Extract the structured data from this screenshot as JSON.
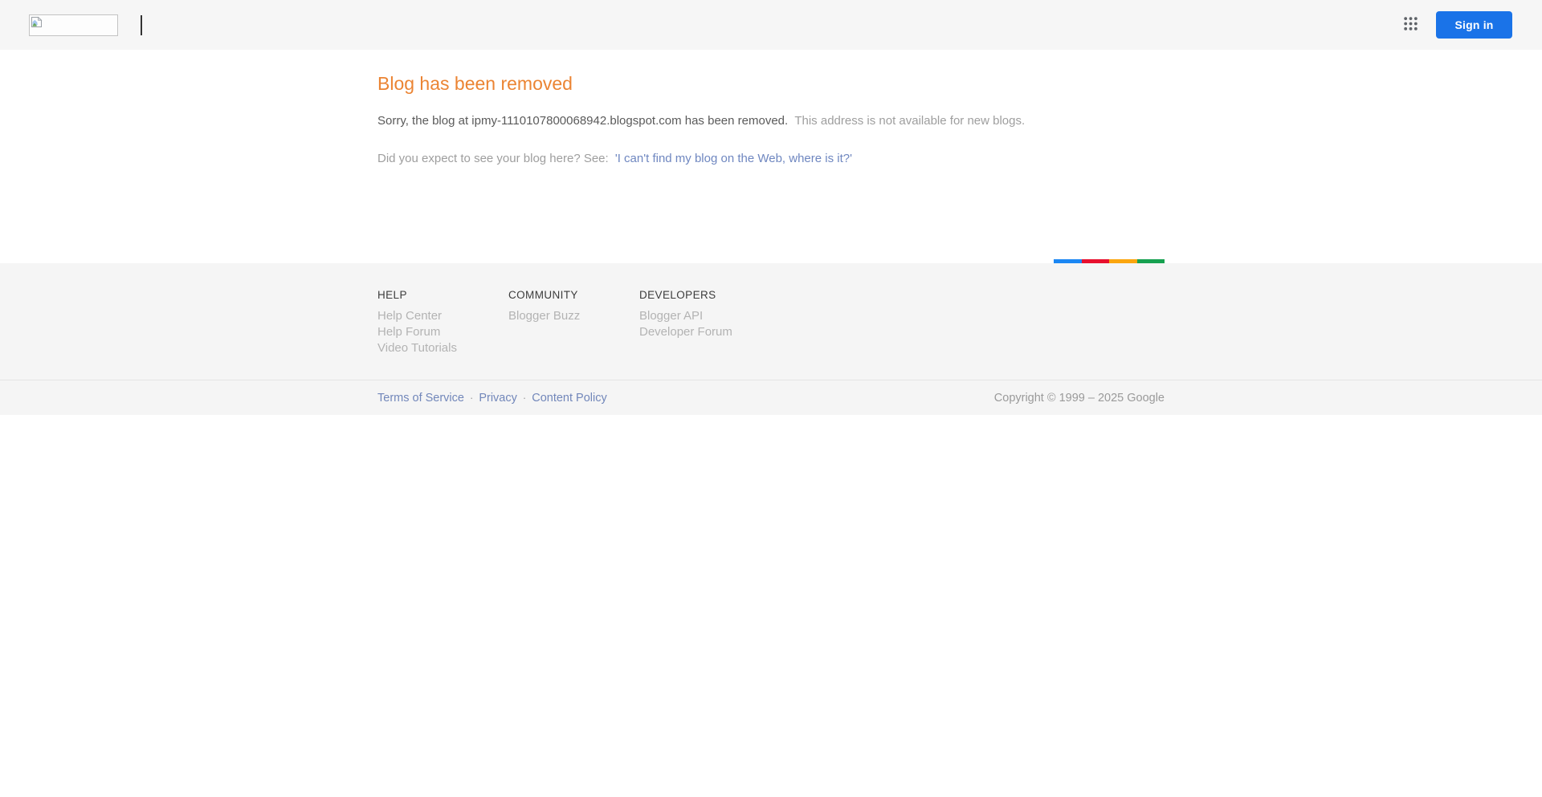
{
  "header": {
    "signin_label": "Sign in"
  },
  "icons": {
    "logo": "broken-image-icon",
    "apps": "google-apps-grid-icon",
    "caret": "text-caret"
  },
  "main": {
    "title": "Blog has been removed",
    "message_primary": "Sorry, the blog at ipmy-1110107800068942.blogspot.com has been removed.",
    "message_secondary": "This address is not available for new blogs.",
    "question": "Did you expect to see your blog here? See:",
    "link_text": "'I can't find my blog on the Web, where is it?'"
  },
  "colorbar": {
    "colors": [
      "#1b87f3",
      "#e8102e",
      "#fba60f",
      "#16a150"
    ]
  },
  "footer": {
    "columns": [
      {
        "heading": "HELP",
        "links": [
          "Help Center",
          "Help Forum",
          "Video Tutorials"
        ]
      },
      {
        "heading": "COMMUNITY",
        "links": [
          "Blogger Buzz"
        ]
      },
      {
        "heading": "DEVELOPERS",
        "links": [
          "Blogger API",
          "Developer Forum"
        ]
      }
    ]
  },
  "bottombar": {
    "links": [
      "Terms of Service",
      "Privacy",
      "Content Policy"
    ],
    "separator": "·",
    "copyright": "Copyright © 1999 – 2025 Google"
  },
  "colors": {
    "signin_button": "#1a73e8",
    "title_orange": "#eb8433",
    "header_bg": "#f6f6f6",
    "footer_bg": "#f5f5f5",
    "link_blue": "#7287ba"
  }
}
